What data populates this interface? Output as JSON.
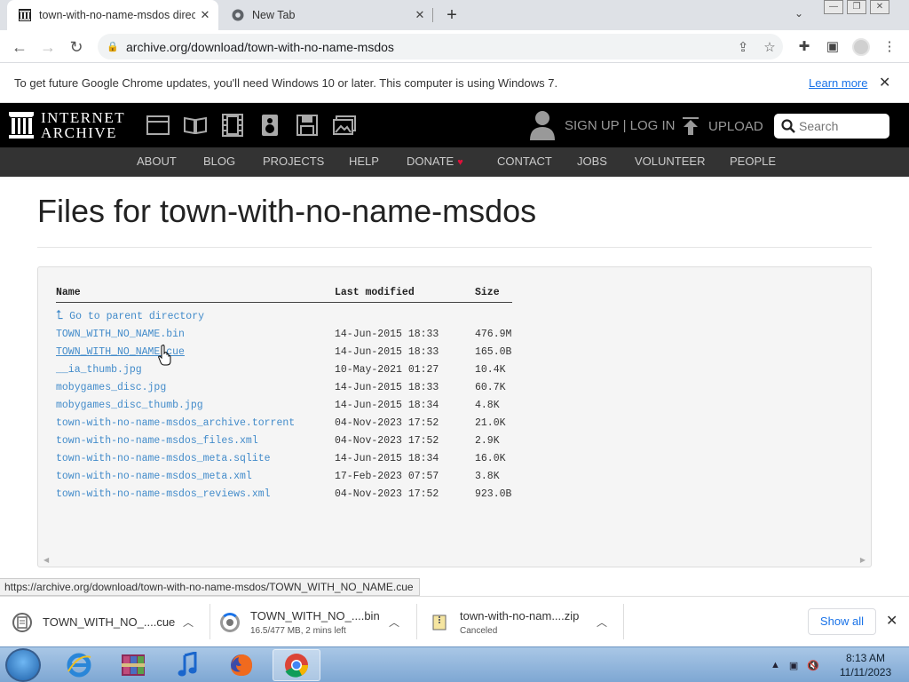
{
  "browser": {
    "tabs": [
      {
        "title": "town-with-no-name-msdos direc",
        "close": "✕"
      },
      {
        "title": "New Tab",
        "close": "✕"
      }
    ],
    "new_tab": "+",
    "url": "archive.org/download/town-with-no-name-msdos",
    "window_controls": {
      "minimize": "—",
      "maximize": "❐",
      "close": "✕"
    },
    "tab_search": "⌄"
  },
  "infobar": {
    "message": "To get future Google Chrome updates, you'll need Windows 10 or later. This computer is using Windows 7.",
    "link": "Learn more",
    "close": "✕"
  },
  "ia_header": {
    "logo_line1": "INTERNET",
    "logo_line2": "ARCHIVE",
    "signup": "SIGN UP | LOG IN",
    "upload": "UPLOAD",
    "search_placeholder": "Search"
  },
  "ia_nav": [
    "ABOUT",
    "BLOG",
    "PROJECTS",
    "HELP",
    "DONATE",
    "CONTACT",
    "JOBS",
    "VOLUNTEER",
    "PEOPLE"
  ],
  "page": {
    "title": "Files for town-with-no-name-msdos",
    "columns": [
      "Name",
      "Last modified",
      "Size"
    ],
    "parent_link": "Go to parent directory",
    "files": [
      {
        "name": "TOWN_WITH_NO_NAME.bin",
        "modified": "14-Jun-2015 18:33",
        "size": "476.9M"
      },
      {
        "name": "TOWN_WITH_NO_NAME.cue",
        "modified": "14-Jun-2015 18:33",
        "size": "165.0B"
      },
      {
        "name": "__ia_thumb.jpg",
        "modified": "10-May-2021 01:27",
        "size": "10.4K"
      },
      {
        "name": "mobygames_disc.jpg",
        "modified": "14-Jun-2015 18:33",
        "size": "60.7K"
      },
      {
        "name": "mobygames_disc_thumb.jpg",
        "modified": "14-Jun-2015 18:34",
        "size": "4.8K"
      },
      {
        "name": "town-with-no-name-msdos_archive.torrent",
        "modified": "04-Nov-2023 17:52",
        "size": "21.0K"
      },
      {
        "name": "town-with-no-name-msdos_files.xml",
        "modified": "04-Nov-2023 17:52",
        "size": "2.9K"
      },
      {
        "name": "town-with-no-name-msdos_meta.sqlite",
        "modified": "14-Jun-2015 18:34",
        "size": "16.0K"
      },
      {
        "name": "town-with-no-name-msdos_meta.xml",
        "modified": "17-Feb-2023 07:57",
        "size": "3.8K"
      },
      {
        "name": "town-with-no-name-msdos_reviews.xml",
        "modified": "04-Nov-2023 17:52",
        "size": "923.0B"
      }
    ]
  },
  "status_url": "https://archive.org/download/town-with-no-name-msdos/TOWN_WITH_NO_NAME.cue",
  "downloads": [
    {
      "name": "TOWN_WITH_NO_....cue",
      "sub": ""
    },
    {
      "name": "TOWN_WITH_NO_....bin",
      "sub": "16.5/477 MB, 2 mins left"
    },
    {
      "name": "town-with-no-nam....zip",
      "sub": "Canceled"
    }
  ],
  "shelf": {
    "show_all": "Show all",
    "close": "✕"
  },
  "taskbar": {
    "time": "8:13 AM",
    "date": "11/11/2023"
  }
}
